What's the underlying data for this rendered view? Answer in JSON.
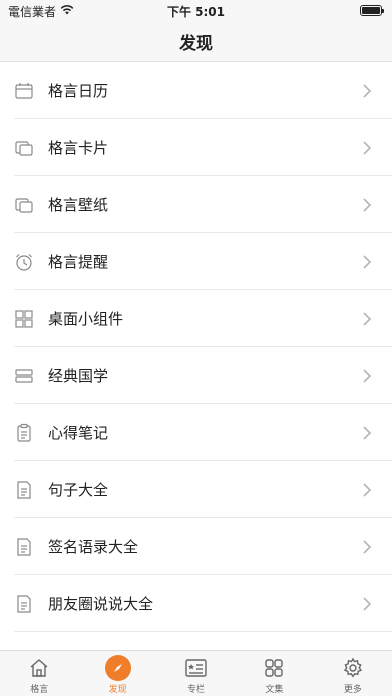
{
  "status_bar": {
    "carrier": "電信業者",
    "time": "下午 5:01",
    "battery_level": 1.0
  },
  "nav": {
    "title": "发现"
  },
  "list": {
    "items": [
      {
        "label": "格言日历",
        "icon": "calendar-icon"
      },
      {
        "label": "格言卡片",
        "icon": "cards-icon"
      },
      {
        "label": "格言壁纸",
        "icon": "wallpaper-icon"
      },
      {
        "label": "格言提醒",
        "icon": "alarm-clock-icon"
      },
      {
        "label": "桌面小组件",
        "icon": "widgets-icon"
      },
      {
        "label": "经典国学",
        "icon": "books-icon"
      },
      {
        "label": "心得笔记",
        "icon": "clipboard-icon"
      },
      {
        "label": "句子大全",
        "icon": "document-icon"
      },
      {
        "label": "签名语录大全",
        "icon": "document-icon"
      },
      {
        "label": "朋友圈说说大全",
        "icon": "document-icon"
      }
    ]
  },
  "tabs": [
    {
      "label": "格言",
      "icon": "home-icon",
      "active": false
    },
    {
      "label": "发现",
      "icon": "compass-icon",
      "active": true
    },
    {
      "label": "专栏",
      "icon": "column-icon",
      "active": false
    },
    {
      "label": "文集",
      "icon": "grid-icon",
      "active": false
    },
    {
      "label": "更多",
      "icon": "gear-icon",
      "active": false
    }
  ],
  "colors": {
    "accent": "#f07d2a",
    "icon_gray": "#8a8a8a"
  }
}
